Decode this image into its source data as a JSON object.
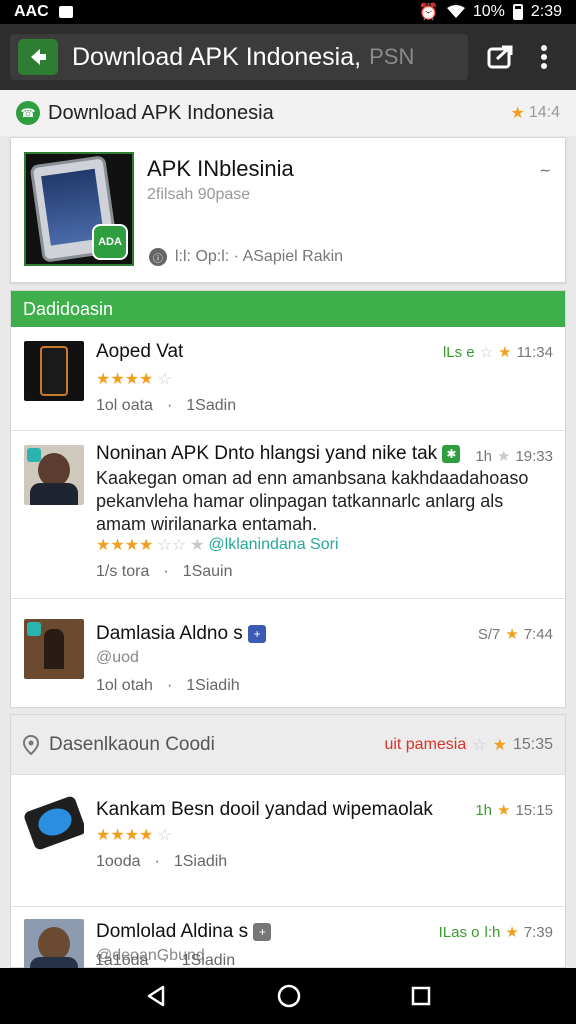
{
  "status_bar": {
    "left_text": "AAC",
    "battery": "10%",
    "time": "2:39"
  },
  "toolbar": {
    "url_text": "Download  APK Indonesia,",
    "url_extra": "PSN"
  },
  "site_header": {
    "title": "Download APK Indonesia",
    "rating": "14:4"
  },
  "featured": {
    "title": "APK INblesinia",
    "subtitle": "2filsah 90pase",
    "badge_text": "ADA",
    "meta": "l:l: Op:l: · ASapiel  Rakin"
  },
  "section1": {
    "header": "Dadidoasin",
    "items": [
      {
        "title": "Aoped Vat",
        "stars": "★★★★",
        "stars_empty": "☆",
        "footer_left": "1ol oata",
        "footer_right": "1Sadin",
        "right_label": "lLs e",
        "right_time": "11:34"
      },
      {
        "title": "Noninan APK Dnto hlangsi yand nike tak",
        "desc": "Kaakegan oman ad enn amanbsana kakhdaadahoaso pekanvleha hamar olinpagan tatkannarlc anlarg als amam wirilanarka entamah.",
        "stars": "★★★★",
        "stars_empty": "☆☆",
        "link": "@lklanindana Sori",
        "footer_left": "1/s tora",
        "footer_right": "1Sauin",
        "right_label": "1h",
        "right_time": "19:33"
      },
      {
        "title": "Damlasia Aldno s",
        "sub": "@uod",
        "footer_left": "1ol otah",
        "footer_right": "1Siadih",
        "right_label": "S/7",
        "right_time": "7:44"
      }
    ]
  },
  "section2": {
    "header": "Dasenlkaoun Coodi",
    "header_right": "uit pamesia",
    "header_time": "15:35",
    "items": [
      {
        "title": "Kankam Besn dooil yandad wipemaolak",
        "stars": "★★★★",
        "stars_empty": "☆",
        "footer_left": "1ooda",
        "footer_right": "1Siadih",
        "right_label": "1h",
        "right_time": "15:15"
      },
      {
        "title": "Domlolad Aldina s",
        "sub": "@deoanGbund",
        "footer_left": "1a1oda",
        "footer_right": "1Siadin",
        "right_label": "ILas o",
        "right_extra": "l:h",
        "right_time": "7:39"
      }
    ]
  }
}
